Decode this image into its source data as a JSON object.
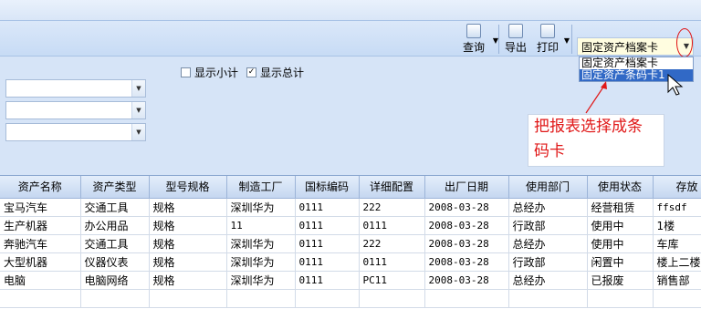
{
  "toolbar": {
    "query_label": "查询",
    "export_label": "导出",
    "print_label": "打印",
    "report_select_value": "固定资产档案卡"
  },
  "dropdown": {
    "options": [
      "固定资产档案卡",
      "固定资产条码卡1"
    ],
    "highlighted": 1
  },
  "filters": {
    "show_subtotal_label": "显示小计",
    "show_subtotal_checked": false,
    "show_total_label": "显示总计",
    "show_total_checked": true
  },
  "annotation": {
    "line1": "把报表选择成条",
    "line2": "码卡"
  },
  "grid": {
    "columns": [
      "资产名称",
      "资产类型",
      "型号规格",
      "制造工厂",
      "国标编码",
      "详细配置",
      "出厂日期",
      "使用部门",
      "使用状态",
      "存放"
    ],
    "rows": [
      [
        "宝马汽车",
        "交通工具",
        "规格",
        "深圳华为",
        "0111",
        "222",
        "2008-03-28",
        "总经办",
        "经营租赁",
        "ffsdf"
      ],
      [
        "生产机器",
        "办公用品",
        "规格",
        "11",
        "0111",
        "0111",
        "2008-03-28",
        "行政部",
        "使用中",
        "1楼"
      ],
      [
        "奔驰汽车",
        "交通工具",
        "规格",
        "深圳华为",
        "0111",
        "222",
        "2008-03-28",
        "总经办",
        "使用中",
        "车库"
      ],
      [
        "大型机器",
        "仪器仪表",
        "规格",
        "深圳华为",
        "0111",
        "0111",
        "2008-03-28",
        "行政部",
        "闲置中",
        "楼上二楼"
      ],
      [
        "电脑",
        "电脑网络",
        "规格",
        "深圳华为",
        "0111",
        "PC11",
        "2008-03-28",
        "总经办",
        "已报废",
        "销售部"
      ]
    ]
  },
  "colors": {
    "annotation_red": "#e01818",
    "selected_option": "#3169c6"
  }
}
